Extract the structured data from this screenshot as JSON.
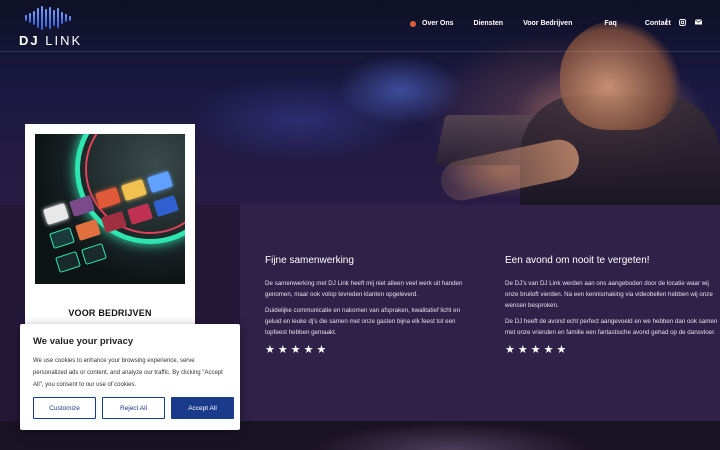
{
  "header": {
    "logo_primary": "DJ",
    "logo_secondary": "LINK",
    "nav": [
      "Over Ons",
      "Diensten",
      "Voor Bedrijven",
      "Faq",
      "Contact"
    ],
    "social_icons": [
      "facebook-icon",
      "instagram-icon",
      "mail-icon"
    ]
  },
  "card": {
    "title": "VOOR BEDRIJVEN"
  },
  "testimonials": [
    {
      "title": "Fijne samenwerking",
      "paragraphs": [
        "De samenwerking met DJ Link heeft mij niet alleen veel werk uit handen genomen, maar ook volop tevreden klanten opgeleverd.",
        "Duidelijke communicatie en nakomen van afspraken, kwalitatief licht en geluid en leuke dj’s die samen met onze gasten bijna elk feest tot een topfeest hebben gemaakt."
      ],
      "stars": "★★★★★",
      "rating": 5
    },
    {
      "title": "Een avond om nooit te vergeten!",
      "paragraphs": [
        "De DJ’s van DJ Link werden aan ons aangeboden door de locatie waar wij onze bruiloft vierden. Na een kennismaking via videobellen hebben wij onze wensen besproken.",
        "De DJ heeft de avond echt perfect aangevoeld en we hebben dan ook samen met onze vrienden en familie een fantastische avond gehad op de dansvloer."
      ],
      "stars": "★★★★★",
      "rating": 5
    }
  ],
  "cookie": {
    "title": "We value your privacy",
    "text": "We use cookies to enhance your browsing experience, serve personalized ads or content, and analyze our traffic. By clicking \"Accept All\", you consent to our use of cookies.",
    "customize": "Customize",
    "reject": "Reject All",
    "accept": "Accept All"
  },
  "colors": {
    "accent": "#e0603c",
    "button": "#1a3a8c",
    "section": "#2f2147"
  }
}
